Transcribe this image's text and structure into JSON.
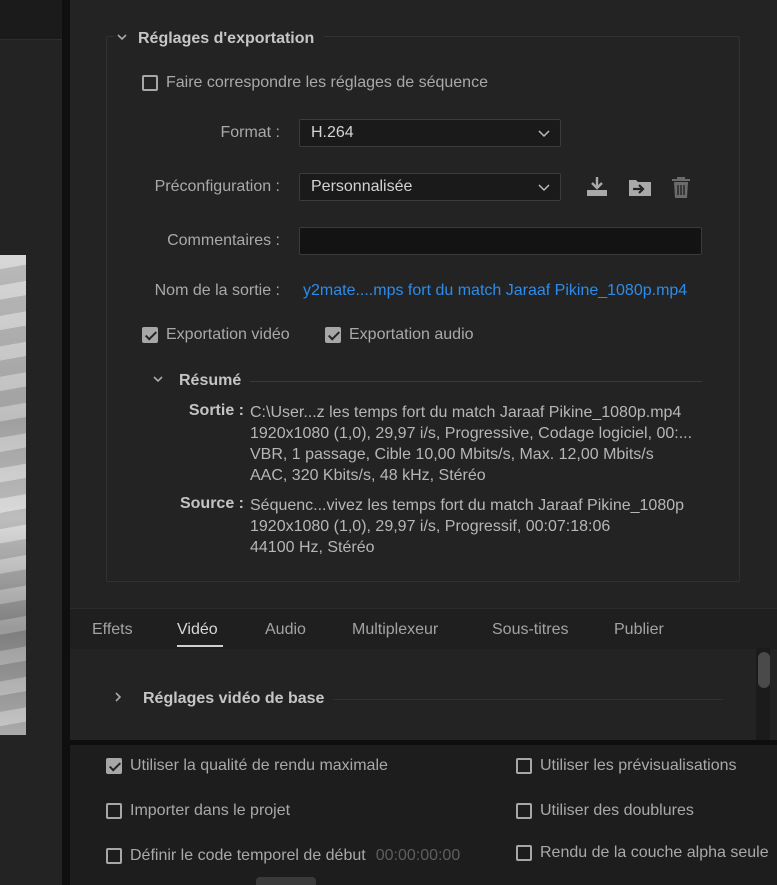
{
  "export_settings": {
    "title": "Réglages d'exportation",
    "match_sequence": {
      "label": "Faire correspondre les réglages de séquence",
      "checked": false
    },
    "format": {
      "label": "Format :",
      "value": "H.264"
    },
    "preset": {
      "label": "Préconfiguration :",
      "value": "Personnalisée"
    },
    "comments": {
      "label": "Commentaires :",
      "value": ""
    },
    "output_name": {
      "label": "Nom de la sortie :",
      "value": "y2mate....mps fort du match Jaraaf  Pikine_1080p.mp4"
    },
    "export_video": {
      "label": "Exportation vidéo",
      "checked": true
    },
    "export_audio": {
      "label": "Exportation audio",
      "checked": true
    }
  },
  "summary": {
    "title": "Résumé",
    "output_label": "Sortie :",
    "output_lines": [
      "C:\\User...z les temps fort du match Jaraaf  Pikine_1080p.mp4",
      "1920x1080 (1,0), 29,97 i/s, Progressive, Codage logiciel, 00:...",
      "VBR, 1 passage, Cible 10,00  Mbits/s, Max. 12,00  Mbits/s",
      "AAC, 320  Kbits/s, 48  kHz, Stéréo"
    ],
    "source_label": "Source :",
    "source_lines": [
      "Séquenc...vivez les temps fort du match Jaraaf  Pikine_1080p",
      "1920x1080 (1,0), 29,97  i/s, Progressif, 00:07:18:06",
      "44100 Hz, Stéréo"
    ]
  },
  "tabs": [
    {
      "label": "Effets",
      "active": false
    },
    {
      "label": "Vidéo",
      "active": true
    },
    {
      "label": "Audio",
      "active": false
    },
    {
      "label": "Multiplexeur",
      "active": false
    },
    {
      "label": "Sous-titres",
      "active": false
    },
    {
      "label": "Publier",
      "active": false
    }
  ],
  "video_section": {
    "title": "Réglages vidéo de base"
  },
  "bottom": {
    "max_render_quality": {
      "label": "Utiliser la qualité de rendu maximale",
      "checked": true
    },
    "use_previews": {
      "label": "Utiliser les prévisualisations",
      "checked": false
    },
    "import_project": {
      "label": "Importer dans le projet",
      "checked": false
    },
    "use_proxies": {
      "label": "Utiliser des doublures",
      "checked": false
    },
    "start_timecode": {
      "label": "Définir le code temporel de début",
      "checked": false,
      "value": "00:00:00:00"
    },
    "render_alpha": {
      "label": "Rendu de la couche alpha seule",
      "checked": false
    }
  },
  "icons": {
    "save_preset": "download-tray-icon",
    "import_preset": "folder-import-icon",
    "delete_preset": "trash-icon"
  },
  "colors": {
    "link": "#2d8ceb",
    "panel_bg": "#232323"
  }
}
